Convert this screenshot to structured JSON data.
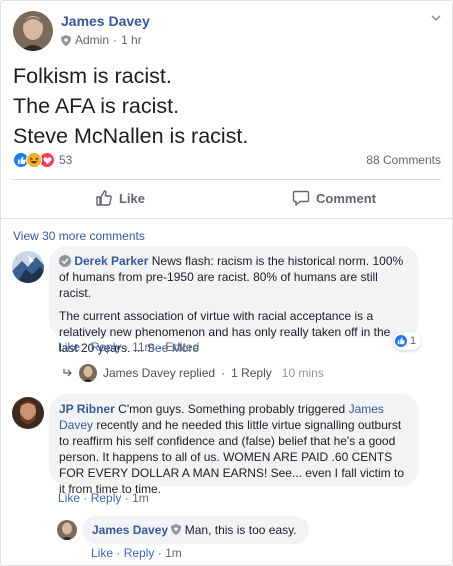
{
  "post": {
    "author": "James Davey",
    "role": "Admin",
    "time": "1 hr",
    "lines": [
      "Folkism is racist.",
      "The AFA is racist.",
      "Steve McNallen is racist."
    ],
    "reaction_count": "53",
    "comment_count": "88 Comments",
    "like_label": "Like",
    "comment_label": "Comment"
  },
  "view_more": "View 30 more comments",
  "comments": [
    {
      "author": "Derek Parker",
      "text_1": " News flash: racism is the historical norm. 100% of humans from pre-1950 are racist. 80% of humans are still racist.",
      "text_2": "The current association of virtue with racial acceptance is a relatively new phenomenon and has only really taken off in the last 20 years.",
      "see_more": "... See More",
      "like": "Like",
      "reply": "Reply",
      "time": "11m",
      "edited": "Edited",
      "reaction_count": "1",
      "replied_by": "James Davey",
      "replied_text": "replied",
      "replies_label": "1 Reply",
      "replied_time": "10 mins"
    },
    {
      "author": "JP Ribner",
      "text_a": " C'mon guys. Something probably triggered ",
      "mention": "James Davey",
      "text_b": " recently and he needed this little virtue signalling outburst to reaffirm his self confidence and (false) belief that he's a good person. It happens to all of us. WOMEN ARE PAID .60 CENTS FOR EVERY DOLLAR A MAN EARNS! See... even I fall victim to it from time to time.",
      "like": "Like",
      "reply": "Reply",
      "time": "1m"
    },
    {
      "author": "James Davey",
      "text": "Man, this is too easy.",
      "like": "Like",
      "reply": "Reply",
      "time": "1m"
    }
  ],
  "colors": {
    "link": "#385898",
    "like_blue": "#4267b2",
    "bubble": "#f2f3f5",
    "muted": "#616770"
  }
}
